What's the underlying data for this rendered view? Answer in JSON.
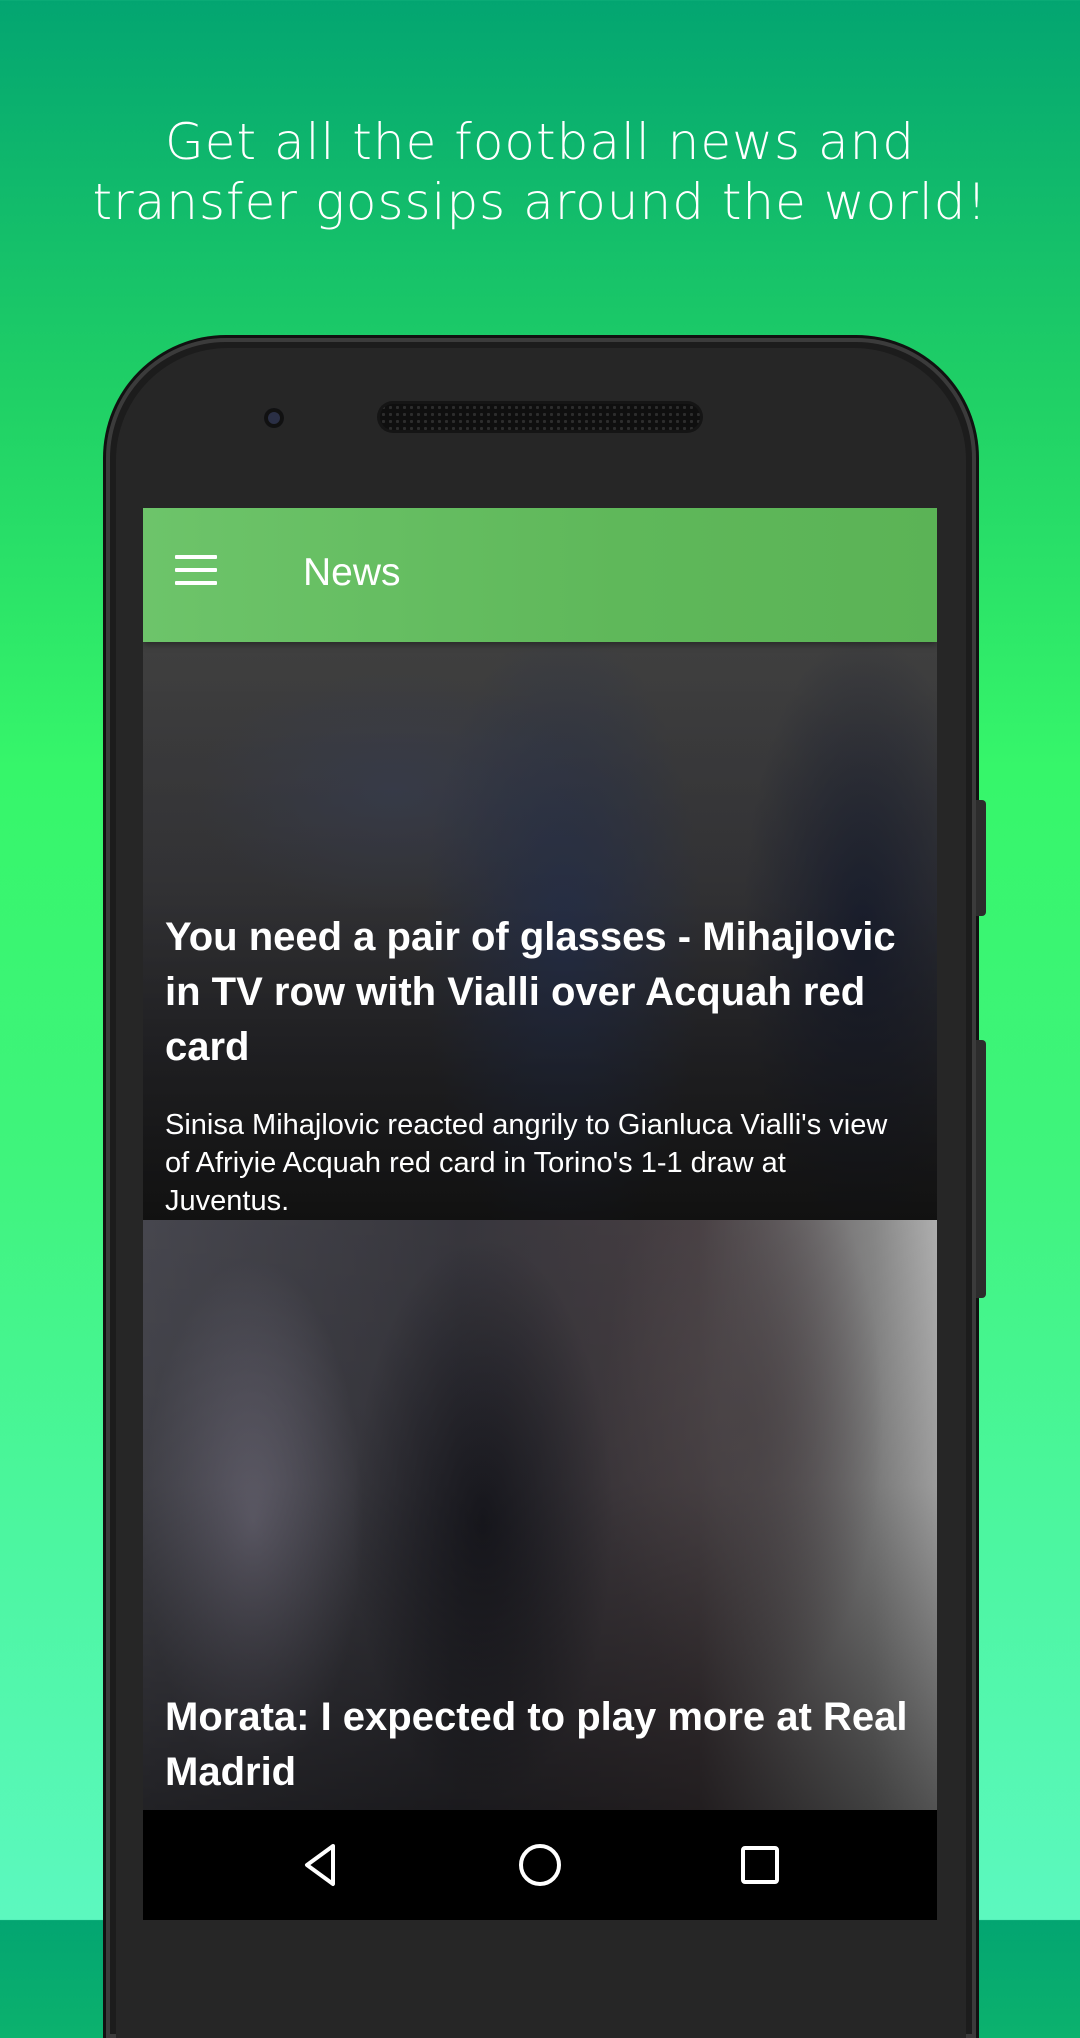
{
  "promo": {
    "line1": "Get all the football news and",
    "line2": "transfer gossips around the world!"
  },
  "appbar": {
    "menu_icon": "hamburger-menu-icon",
    "title": "News"
  },
  "articles": [
    {
      "title": "You need a pair of glasses - Mihajlovic in TV row with Vialli over Acquah red card",
      "summary": "Sinisa Mihajlovic reacted angrily to Gianluca Vialli's view of Afriyie Acquah red card in Torino's 1-1 draw at Juventus."
    },
    {
      "title": "Morata: I expected to play more at Real Madrid"
    }
  ],
  "navbar": {
    "back_icon": "back-triangle-icon",
    "home_icon": "home-circle-icon",
    "recents_icon": "recents-square-icon"
  },
  "colors": {
    "appbar": "#5fb85a",
    "background_top": "#03a571",
    "background_bottom": "#5cf8bf"
  }
}
